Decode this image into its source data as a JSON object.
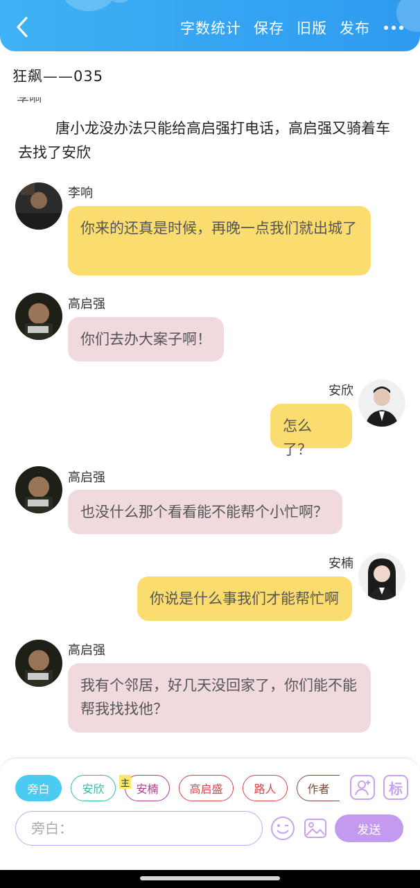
{
  "header": {
    "actions": [
      "字数统计",
      "保存",
      "旧版",
      "发布"
    ]
  },
  "doc": {
    "title": "狂飙——035",
    "cut_text": "李响",
    "narration": "唐小龙没办法只能给高启强打电话，高启强又骑着车去找了安欣"
  },
  "messages": [
    {
      "side": "left",
      "name": "李响",
      "text": "你来的还真是时候，再晚一点我们就出城了",
      "color": "yellow"
    },
    {
      "side": "left",
      "name": "高启强",
      "text": "你们去办大案子啊！",
      "color": "pink"
    },
    {
      "side": "right",
      "name": "安欣",
      "text": "怎么了？",
      "color": "yellow"
    },
    {
      "side": "left",
      "name": "高启强",
      "text": "也没什么那个看看能不能帮个小忙啊？",
      "color": "pink"
    },
    {
      "side": "right",
      "name": "安楠",
      "text": "你说是什么事我们才能帮忙啊",
      "color": "yellow"
    },
    {
      "side": "left",
      "name": "高启强",
      "text": "我有个邻居，好几天没回家了，你们能不能帮我找找他？",
      "color": "pink"
    }
  ],
  "roles": [
    {
      "label": "旁白",
      "active": true,
      "color": "#4ccbf0"
    },
    {
      "label": "安欣",
      "active": false,
      "color": "#35b8a6"
    },
    {
      "label": "安楠",
      "active": false,
      "color": "#b23a8c"
    },
    {
      "label": "高启盛",
      "active": false,
      "color": "#d3474a"
    },
    {
      "label": "路人",
      "active": false,
      "color": "#d3474a"
    },
    {
      "label": "作者",
      "active": false,
      "color": "#7a4a36"
    }
  ],
  "main_tag": "主",
  "tools": {
    "mark_label": "标"
  },
  "input": {
    "placeholder": "旁白："
  },
  "send_label": "发送",
  "icons": [
    "back-icon",
    "more-icon",
    "add-role-icon",
    "mark-icon",
    "emoji-icon",
    "image-icon"
  ],
  "colors": {
    "accent": "#36a5f2",
    "purple": "#c49aee",
    "yellow_bubble": "#fbdc6e",
    "pink_bubble": "#f1dadd"
  }
}
